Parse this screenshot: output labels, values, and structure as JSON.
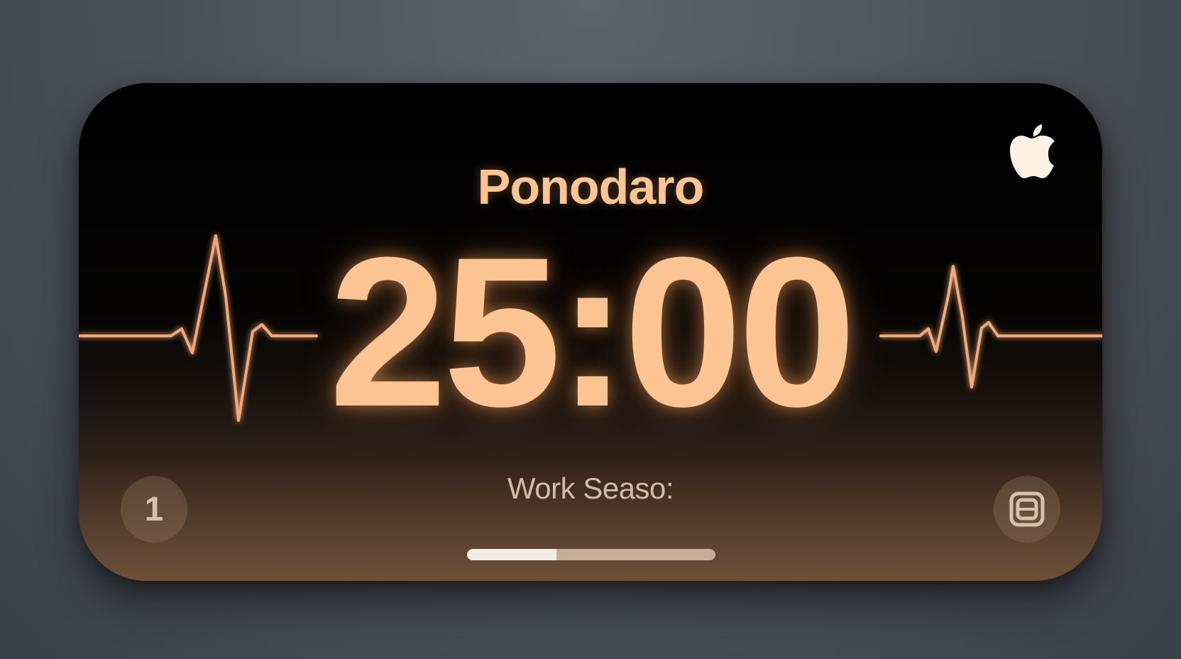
{
  "app": {
    "title": "Ponodaro",
    "timer": "25:00",
    "session_label": "Work Seaso:",
    "round_number": "1",
    "progress": 0.36
  },
  "icons": {
    "brand": "apple-logo-icon",
    "right_button": "layout-window-icon",
    "left_button": "round-counter"
  },
  "colors": {
    "accent": "#fbc492",
    "glow": "#ff9a5a",
    "card_top": "#000000",
    "card_bottom": "#6e5039"
  }
}
